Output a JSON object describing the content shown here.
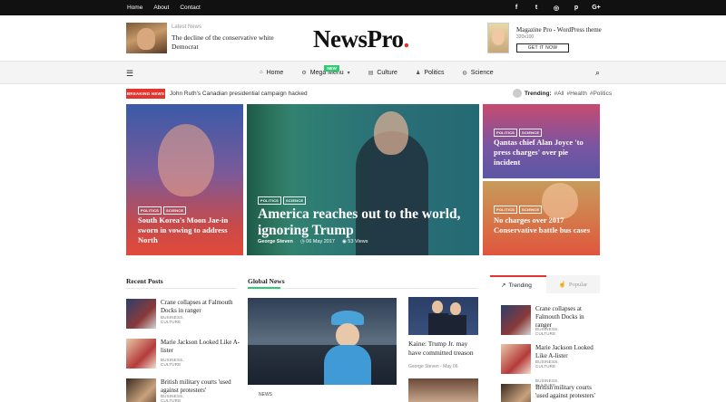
{
  "topbar": {
    "links": [
      "Home",
      "About",
      "Contact"
    ],
    "social": [
      {
        "name": "facebook-icon",
        "glyph": "f"
      },
      {
        "name": "twitter-icon",
        "glyph": "t"
      },
      {
        "name": "instagram-icon",
        "glyph": "◎"
      },
      {
        "name": "pinterest-icon",
        "glyph": "p"
      },
      {
        "name": "google-plus-icon",
        "glyph": "G+"
      }
    ]
  },
  "header": {
    "latest_label": "Latest News",
    "latest_title": "The decline of the conservative white Democrat",
    "logo": "NewsPro",
    "logo_dot": ".",
    "ad_title": "Magazine Pro - WordPress theme",
    "ad_size": "320x100",
    "ad_button": "GET IT NOW"
  },
  "nav": {
    "items": [
      {
        "label": "Home",
        "icon": "home-icon",
        "glyph": "⌂"
      },
      {
        "label": "Mega Menu",
        "icon": "gear-icon",
        "glyph": "⚙",
        "badge": "NEW",
        "caret": "▾"
      },
      {
        "label": "Culture",
        "icon": "book-icon",
        "glyph": "▤"
      },
      {
        "label": "Politics",
        "icon": "user-icon",
        "glyph": "♟"
      },
      {
        "label": "Science",
        "icon": "globe-icon",
        "glyph": "◍"
      }
    ]
  },
  "breaking": {
    "badge": "BREAKING NEWS",
    "text": "John Ruth's Canadian presidential campaign hacked"
  },
  "trending": {
    "label": "Trending:",
    "tags": [
      "#All",
      "#Health",
      "#Politics"
    ]
  },
  "hero": [
    {
      "cats": [
        "POLITICS",
        "SCIENCE"
      ],
      "title": "South Korea's Moon Jae-in sworn in vowing to address North"
    },
    {
      "cats": [
        "POLITICS",
        "SCIENCE"
      ],
      "title": "America reaches out to the world, ignoring Trump",
      "author": "George Steven",
      "date": "06 May 2017",
      "views": "53 Views"
    },
    {
      "cats": [
        "POLITICS",
        "SCIENCE"
      ],
      "title": "Qantas chief Alan Joyce 'to press charges' over pie incident"
    },
    {
      "cats": [
        "POLITICS",
        "SCIENCE"
      ],
      "title": "No charges over 2017 Conservative battle bus cases"
    }
  ],
  "recent": {
    "heading": "Recent Posts",
    "posts": [
      {
        "title": "Crane collapses at Falmouth Docks in ranger",
        "cat": "BUSINESS, CULTURE"
      },
      {
        "title": "Marie Jackson Looked Like A-lister",
        "cat": "BUSINESS, CULTURE"
      },
      {
        "title": "British military courts 'used against protesters'",
        "cat": "BUSINESS, CULTURE"
      }
    ]
  },
  "global": {
    "heading": "Global News",
    "main_tag": "NEWS",
    "side_title": "Kaine: Trump Jr. may have committed treason",
    "side_meta": "George Steven  -  May 06"
  },
  "sidebar": {
    "tab1": "Trending",
    "tab2": "Popular",
    "posts": [
      {
        "title": "Crane collapses at Falmouth Docks in ranger",
        "cat": "BUSINESS, CULTURE"
      },
      {
        "title": "Marie Jackson Looked Like A-lister",
        "cat": "BUSINESS, CULTURE"
      },
      {
        "title": "British military courts 'used against protesters'",
        "cat": "BUSINESS, CULTURE"
      }
    ]
  },
  "colors": {
    "accent": "#e3342f",
    "green": "#2ecc71",
    "topbar": "#111111"
  }
}
